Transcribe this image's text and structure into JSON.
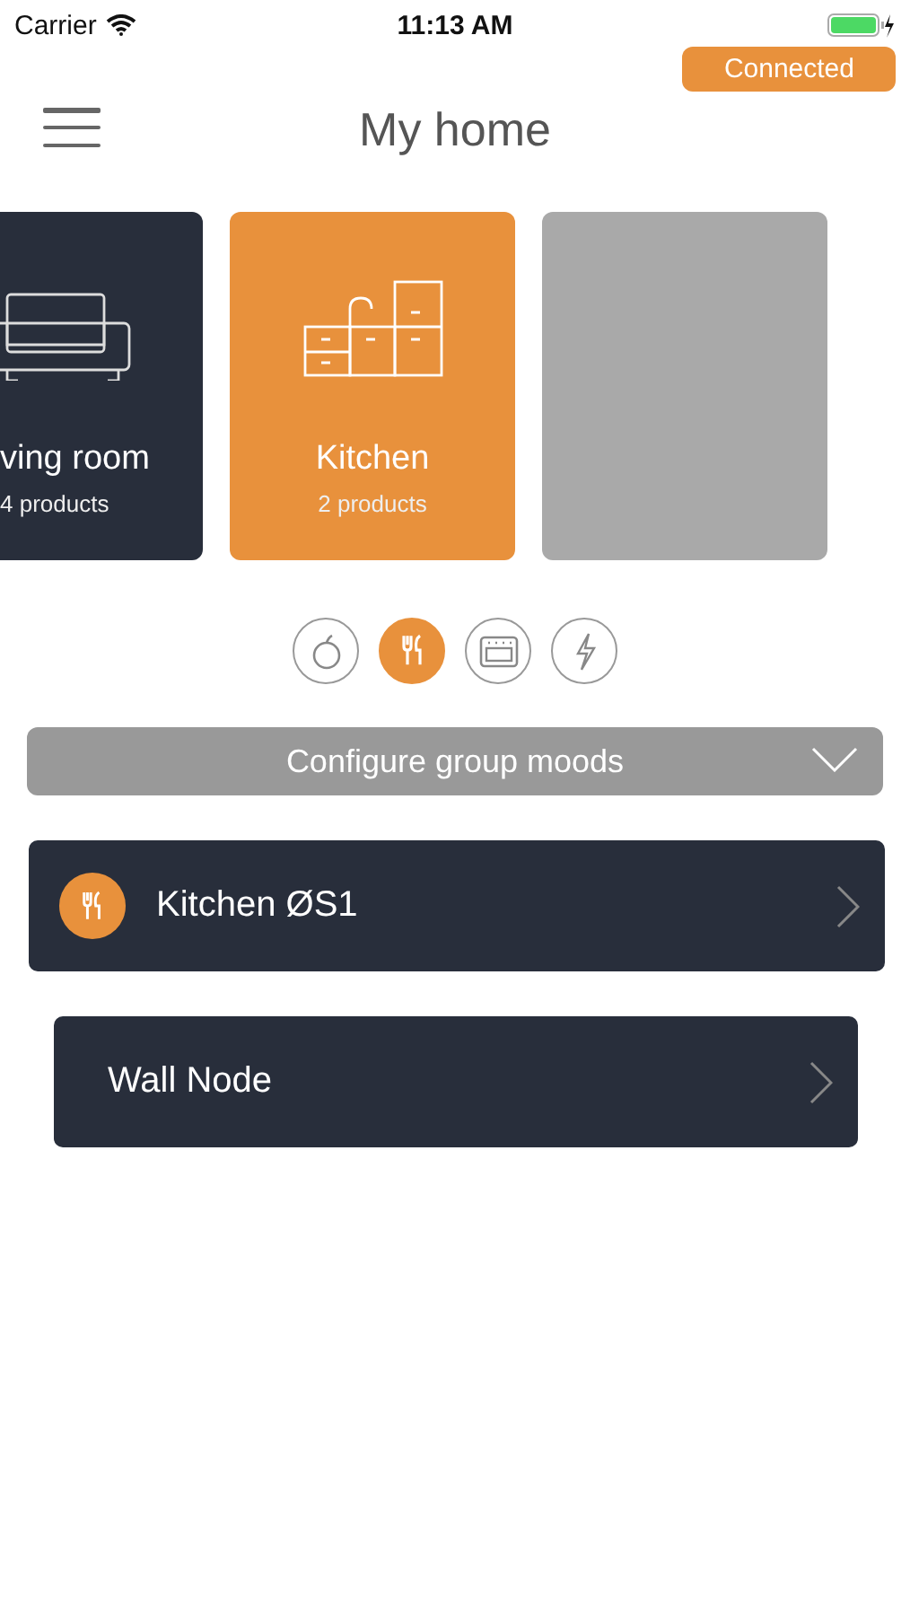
{
  "status_bar": {
    "carrier": "Carrier",
    "time": "11:13 AM"
  },
  "connection": {
    "label": "Connected"
  },
  "title": "My home",
  "rooms": [
    {
      "kind": "sofa",
      "name": "ving room",
      "count": "4 products",
      "selected": false
    },
    {
      "kind": "kitchen",
      "name": "Kitchen",
      "count": "2 products",
      "selected": true
    },
    {
      "kind": "empty",
      "selected": false
    }
  ],
  "categories": [
    {
      "kind": "apple",
      "selected": false
    },
    {
      "kind": "cutlery",
      "selected": true
    },
    {
      "kind": "oven",
      "selected": false
    },
    {
      "kind": "bolt",
      "selected": false
    }
  ],
  "moods": {
    "label": "Configure group moods",
    "expanded": false
  },
  "devices": [
    {
      "kind": "group",
      "name": "Kitchen ØS1"
    },
    {
      "kind": "node",
      "name": "Wall Node"
    }
  ]
}
